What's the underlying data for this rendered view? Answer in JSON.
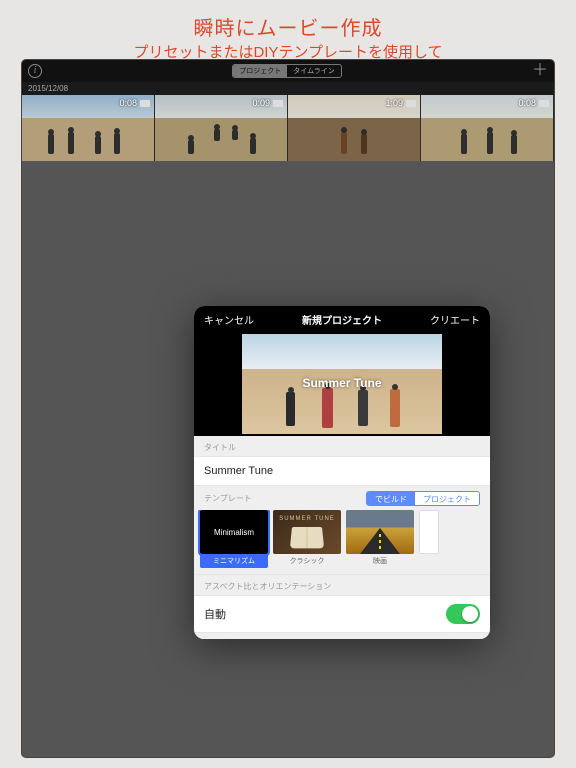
{
  "promo": {
    "title": "瞬時にムービー作成",
    "subtitle": "プリセットまたはDIYテンプレートを使用して"
  },
  "topbar": {
    "seg_a": "プロジェクト",
    "seg_b": "タイムライン"
  },
  "date": "2015/12/08",
  "clips": [
    {
      "dur": "0:08"
    },
    {
      "dur": "0:09"
    },
    {
      "dur": "1:09"
    },
    {
      "dur": "0:08"
    }
  ],
  "modal": {
    "cancel": "キャンセル",
    "title": "新規プロジェクト",
    "create": "クリエート",
    "preview_text": "Summer Tune",
    "title_section": "タイトル",
    "title_value": "Summer Tune",
    "template_section": "テンプレート",
    "seg_build": "でビルド",
    "seg_project": "プロジェクト",
    "templates": [
      {
        "name": "ミニマリズム",
        "thumb_label": "Minimalism"
      },
      {
        "name": "クラシック",
        "thumb_label": "SUMMER TUNE"
      },
      {
        "name": "映画",
        "thumb_label": ""
      },
      {
        "name": "",
        "thumb_label": ""
      }
    ],
    "aspect_section": "アスペクト比とオリエンテーション",
    "auto_label": "自動"
  }
}
